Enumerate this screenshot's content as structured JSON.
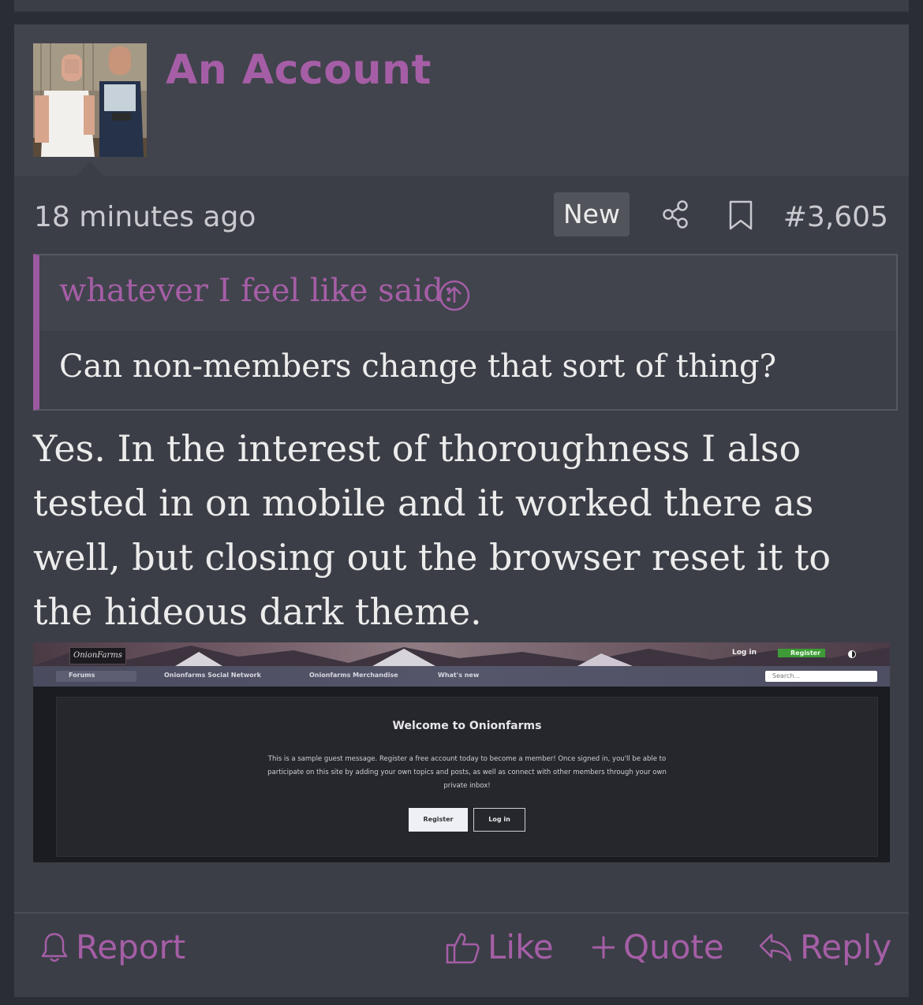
{
  "post": {
    "username": "An Account",
    "time": "18 minutes ago",
    "badge": "New",
    "post_number": "#3,605",
    "quote": {
      "attribution": "whatever I feel like said:",
      "text": "Can non-members change that sort of thing?"
    },
    "message": "Yes. In the interest of thoroughness I also tested in on mobile and it worked there as well, but closing out the browser reset it to the hideous dark theme.",
    "screenshot": {
      "logo": "OnionFarms",
      "login": "Log in",
      "register": "Register",
      "nav": [
        "Forums",
        "Onionfarms Social Network",
        "Onionfarms Merchandise",
        "What's new"
      ],
      "search_placeholder": "Search...",
      "title": "Welcome to Onionfarms",
      "message": "This is a sample guest message. Register a free account today to become a member! Once signed in, you'll be able to participate on this site by adding your own topics and posts, as well as connect with other members through your own private inbox!",
      "register_button": "Register",
      "login_button": "Log in"
    },
    "actions": {
      "report": "Report",
      "like": "Like",
      "quote": "Quote",
      "reply": "Reply"
    }
  },
  "colors": {
    "accent": "#a55ea6",
    "background": "#3b3e46",
    "text": "#ececec"
  }
}
